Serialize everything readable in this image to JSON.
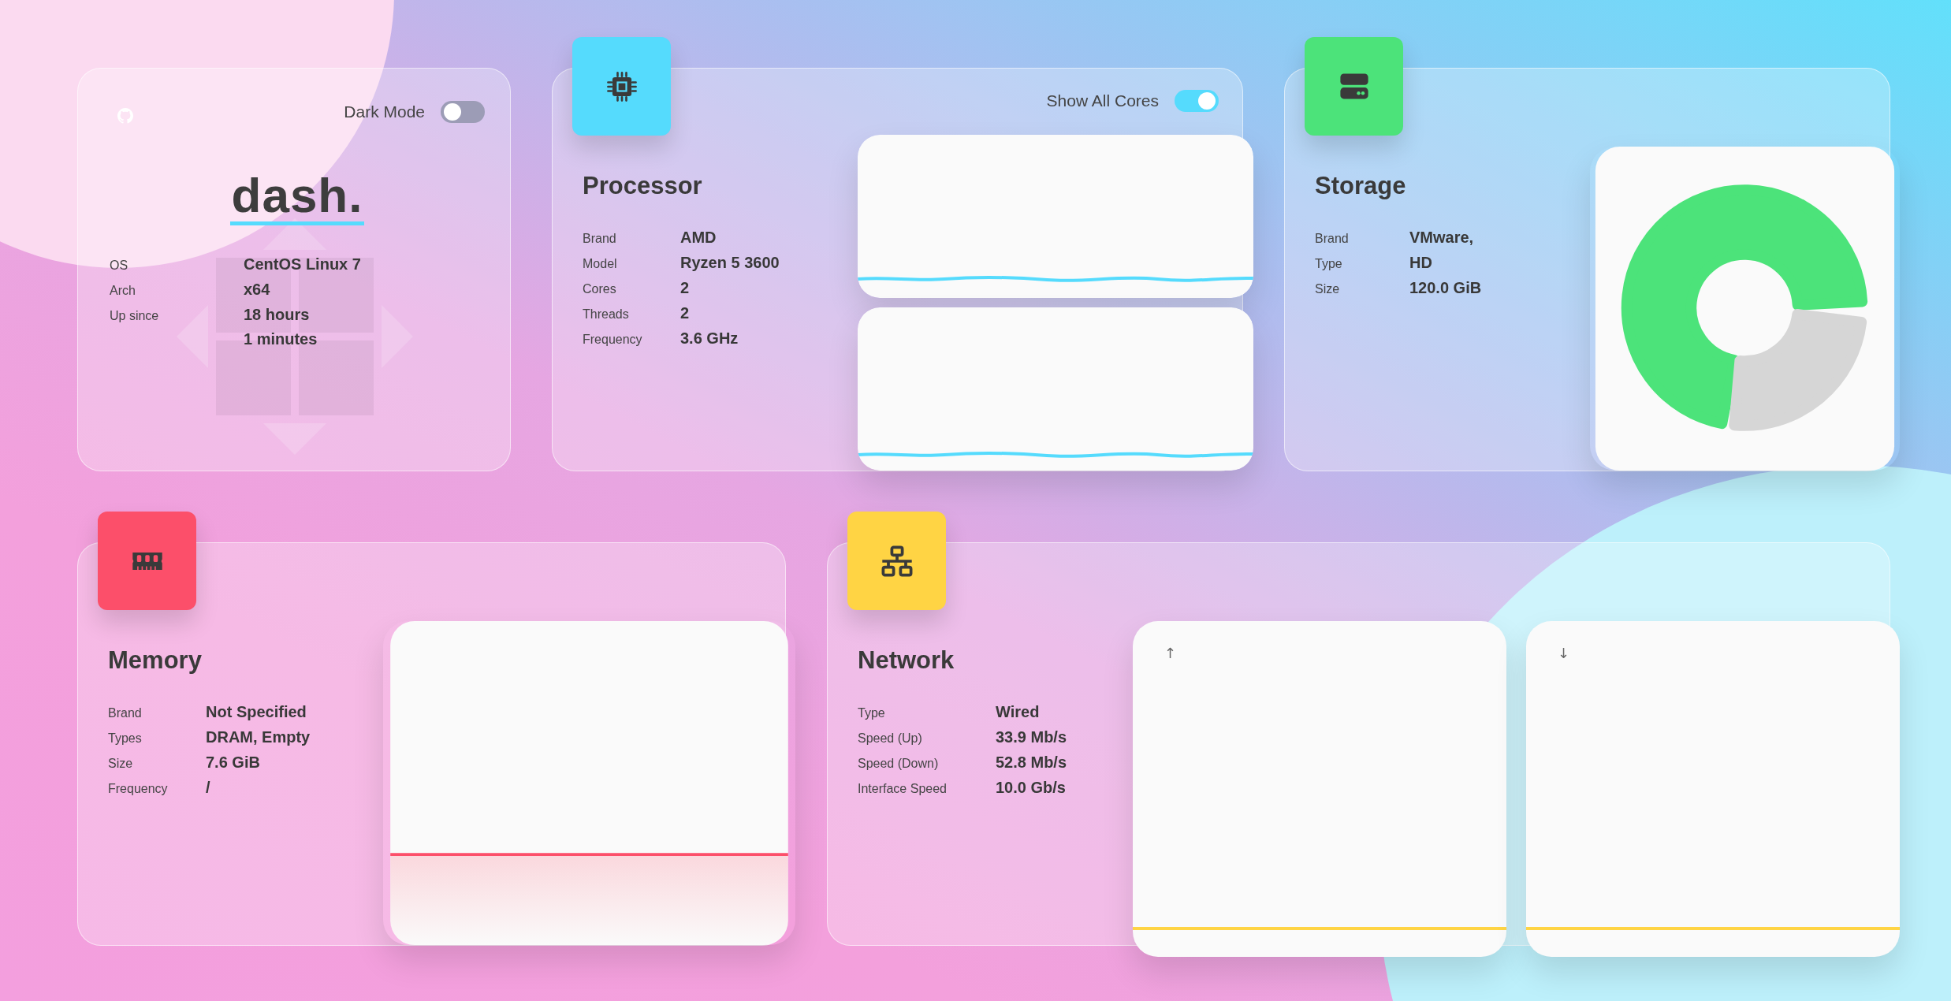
{
  "system": {
    "dark_mode": {
      "label": "Dark Mode",
      "on": false
    },
    "logo": "dash.",
    "rows": [
      {
        "label": "OS",
        "lines": [
          "CentOS Linux 7"
        ]
      },
      {
        "label": "Arch",
        "lines": [
          "x64"
        ]
      },
      {
        "label": "Up since",
        "lines": [
          "18 hours",
          "1 minutes"
        ]
      }
    ]
  },
  "widgets": [
    {
      "kind": "processor",
      "title": "Processor",
      "color": "#55dbfd",
      "toggle": {
        "label": "Show All Cores",
        "on": true
      },
      "rows": [
        {
          "label": "Brand",
          "value": "AMD"
        },
        {
          "label": "Model",
          "value": "Ryzen 5 3600"
        },
        {
          "label": "Cores",
          "value": "2"
        },
        {
          "label": "Threads",
          "value": "2"
        },
        {
          "label": "Frequency",
          "value": "3.6 GHz"
        }
      ]
    },
    {
      "kind": "storage",
      "title": "Storage",
      "color": "#4ce37a",
      "rows": [
        {
          "label": "Brand",
          "value": "VMware,"
        },
        {
          "label": "Type",
          "value": "HD"
        },
        {
          "label": "Size",
          "value": "120.0 GiB"
        }
      ]
    },
    {
      "kind": "memory",
      "title": "Memory",
      "color": "#fc4f6a",
      "rows": [
        {
          "label": "Brand",
          "value": "Not Specified"
        },
        {
          "label": "Types",
          "value": "DRAM, Empty"
        },
        {
          "label": "Size",
          "value": "7.6 GiB"
        },
        {
          "label": "Frequency",
          "value": "/"
        }
      ]
    },
    {
      "kind": "network",
      "title": "Network",
      "color": "#ffd444",
      "rows": [
        {
          "label": "Type",
          "value": "Wired"
        },
        {
          "label": "Speed (Up)",
          "value": "33.9 Mb/s"
        },
        {
          "label": "Speed (Down)",
          "value": "52.8 Mb/s"
        },
        {
          "label": "Interface Speed",
          "value": "10.0 Gb/s"
        }
      ],
      "graphs": [
        {
          "arrow": "↑"
        },
        {
          "arrow": "↓"
        }
      ]
    }
  ]
}
